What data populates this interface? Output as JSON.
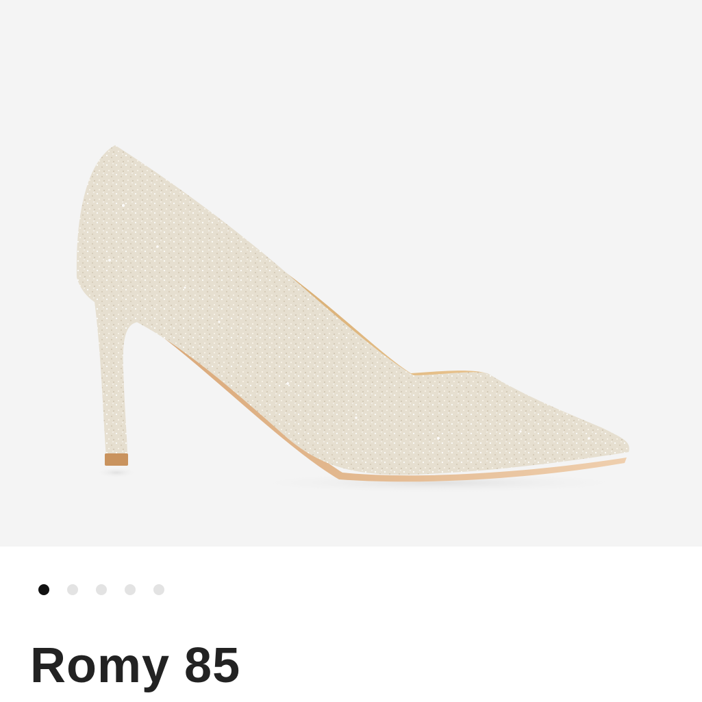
{
  "product": {
    "name": "Romy 85",
    "image": {
      "icon": "glitter-pump-shoe",
      "background_color": "#f4f4f4",
      "shoe_color": "#e8e1d3",
      "lining_color": "#dcb27a"
    }
  },
  "carousel": {
    "total": 5,
    "active_index": 0,
    "active_color": "#111111",
    "inactive_color": "#e3e3e3"
  }
}
